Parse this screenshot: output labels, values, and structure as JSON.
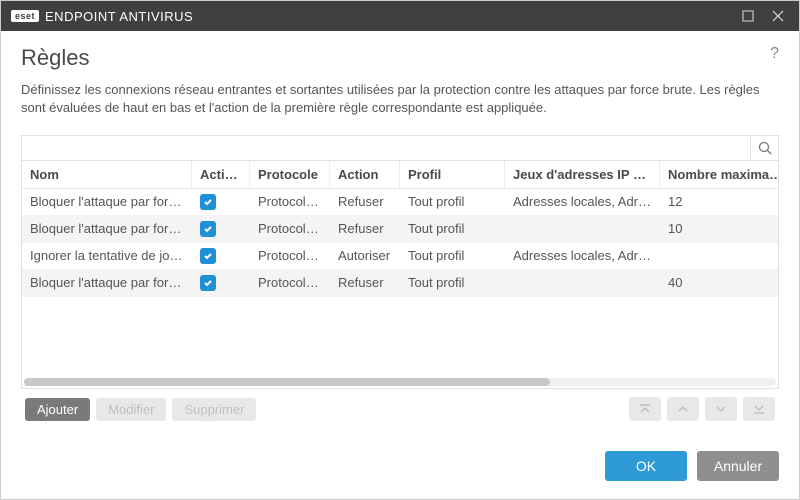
{
  "titlebar": {
    "brand": "eset",
    "product": "ENDPOINT ANTIVIRUS"
  },
  "page": {
    "title": "Règles",
    "description": "Définissez les connexions réseau entrantes et sortantes utilisées par la protection contre les attaques par force brute. Les règles sont évaluées de haut en bas et l'action de la première règle correspondante est appliquée."
  },
  "search": {
    "placeholder": ""
  },
  "columns": {
    "nom": "Nom",
    "active": "Activé(e)",
    "protocole": "Protocole",
    "action": "Action",
    "profil": "Profil",
    "source": "Jeux d'adresses IP source",
    "max": "Nombre maximale d"
  },
  "rows": [
    {
      "nom": "Bloquer l'attaque par force b...",
      "active": true,
      "protocole": "Protocole ...",
      "action": "Refuser",
      "profil": "Tout profil",
      "source": "Adresses locales, Adress...",
      "max": "12"
    },
    {
      "nom": "Bloquer l'attaque par force b...",
      "active": true,
      "protocole": "Protocole ...",
      "action": "Refuser",
      "profil": "Tout profil",
      "source": "",
      "max": "10"
    },
    {
      "nom": "Ignorer la tentative de journ...",
      "active": true,
      "protocole": "Protocole ...",
      "action": "Autoriser",
      "profil": "Tout profil",
      "source": "Adresses locales, Adress...",
      "max": ""
    },
    {
      "nom": "Bloquer l'attaque par force b...",
      "active": true,
      "protocole": "Protocole ...",
      "action": "Refuser",
      "profil": "Tout profil",
      "source": "",
      "max": "40"
    }
  ],
  "actions": {
    "add": "Ajouter",
    "edit": "Modifier",
    "delete": "Supprimer"
  },
  "footer": {
    "ok": "OK",
    "cancel": "Annuler"
  }
}
